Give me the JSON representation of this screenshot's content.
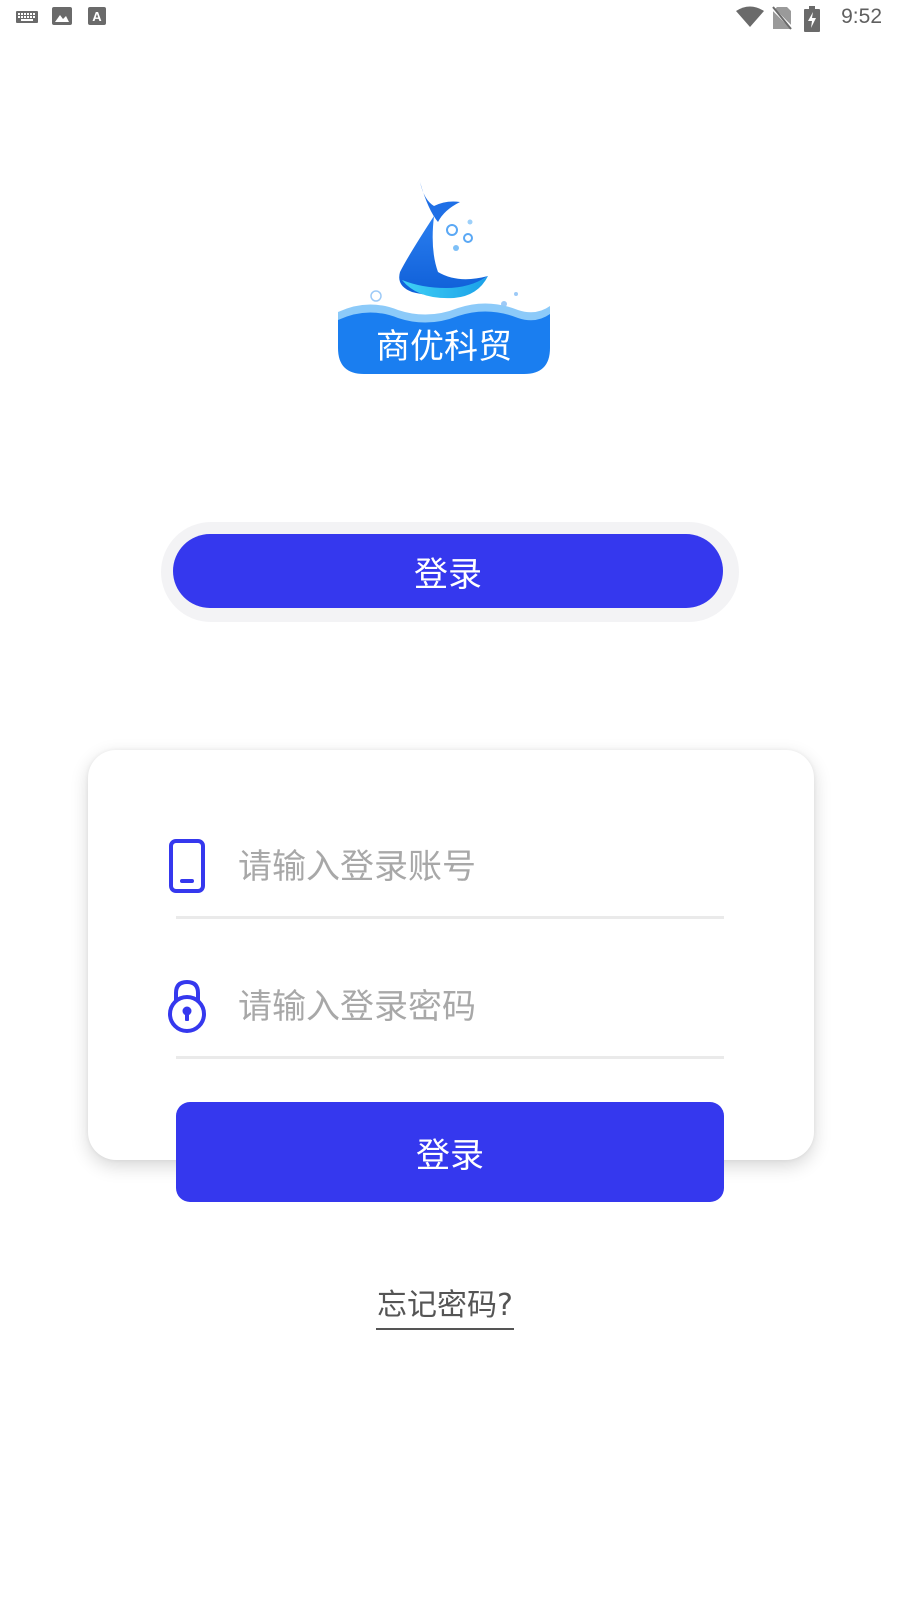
{
  "status_bar": {
    "time": "9:52",
    "left_icons": [
      "keyboard-icon",
      "image-icon",
      "font-a-icon"
    ],
    "right_icons": [
      "wifi-icon",
      "no-sim-icon",
      "battery-charging-icon"
    ]
  },
  "logo": {
    "text": "商优科贸"
  },
  "tabs": {
    "active_label": "登录"
  },
  "form": {
    "account": {
      "placeholder": "请输入登录账号",
      "value": "",
      "icon": "phone-icon"
    },
    "password": {
      "placeholder": "请输入登录密码",
      "value": "",
      "icon": "lock-icon"
    },
    "submit_label": "登录"
  },
  "forgot_password": "忘记密码?",
  "colors": {
    "primary": "#3538ee",
    "logo_blue": "#1a8cf0",
    "placeholder": "#a8a8a8",
    "divider": "#eaeaea"
  }
}
